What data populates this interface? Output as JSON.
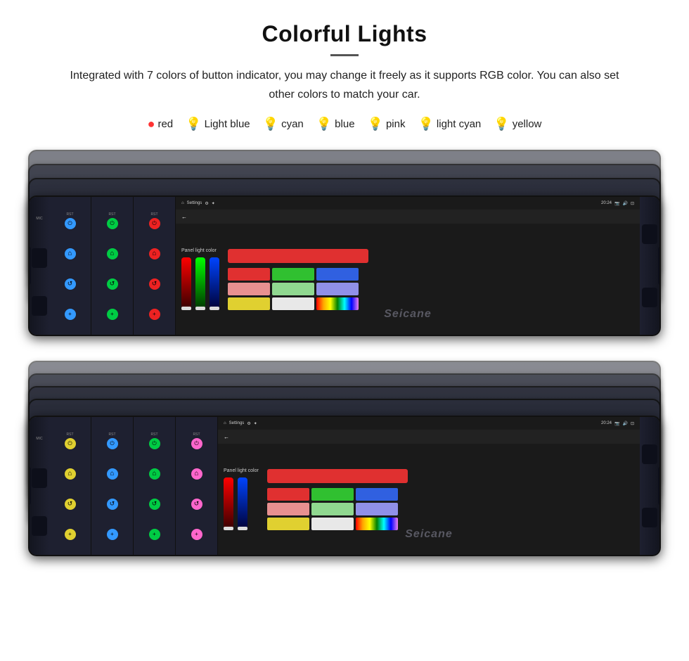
{
  "page": {
    "title": "Colorful Lights",
    "description": "Integrated with 7 colors of button indicator, you may change it freely as it supports RGB color. You can also set other colors to match your car.",
    "divider_char": "—",
    "watermark": "Seicane"
  },
  "legend": {
    "items": [
      {
        "label": "red",
        "color": "#ff3333",
        "bulb": "🔴"
      },
      {
        "label": "Light blue",
        "color": "#88ccff",
        "bulb": "💡"
      },
      {
        "label": "cyan",
        "color": "#00ffff",
        "bulb": "💡"
      },
      {
        "label": "blue",
        "color": "#4488ff",
        "bulb": "💡"
      },
      {
        "label": "pink",
        "color": "#ff66cc",
        "bulb": "💡"
      },
      {
        "label": "light cyan",
        "color": "#aaffee",
        "bulb": "💡"
      },
      {
        "label": "yellow",
        "color": "#ffee44",
        "bulb": "💡"
      }
    ]
  },
  "screen": {
    "title": "Settings",
    "time": "20:24",
    "panel_light_label": "Panel light color",
    "back_arrow": "←",
    "home_icon": "⌂",
    "settings_icon": "⚙"
  },
  "colors": {
    "red": "#e03030",
    "green": "#30c030",
    "blue": "#3060e0",
    "light_red": "#e89090",
    "light_green": "#90d890",
    "light_blue": "#9090e8",
    "yellow": "#e0d030",
    "white": "#e8e8e8",
    "rainbow": "linear-gradient(to right, red, orange, yellow, green, cyan, blue, violet)"
  },
  "button_colors_top": {
    "power": "#3399ff",
    "home": "#3399ff",
    "back": "#3399ff",
    "vol": "#3399ff"
  },
  "button_colors_mid": {
    "power": "#00cc44",
    "home": "#00cc44",
    "back": "#00cc44",
    "vol": "#00cc44"
  },
  "button_colors_bot": {
    "power": "#ee2222",
    "home": "#ee2222",
    "back": "#ee2222",
    "vol": "#ee2222"
  }
}
